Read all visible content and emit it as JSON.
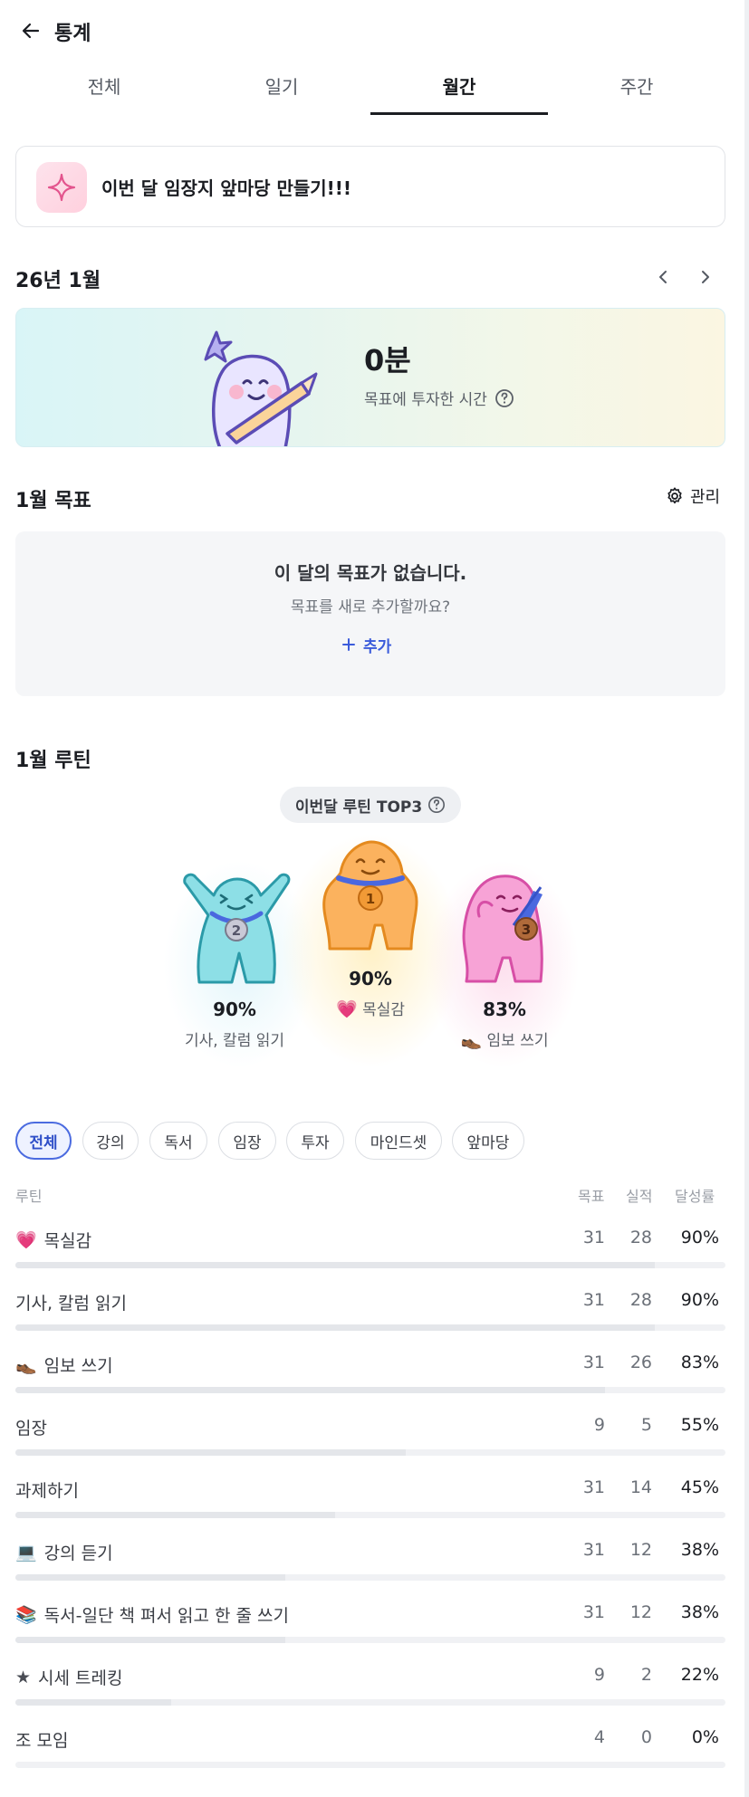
{
  "header": {
    "title": "통계"
  },
  "tabs": [
    {
      "label": "전체",
      "active": false
    },
    {
      "label": "일기",
      "active": false
    },
    {
      "label": "월간",
      "active": true
    },
    {
      "label": "주간",
      "active": false
    }
  ],
  "banner": {
    "text": "이번 달 임장지 앞마당 만들기!!!",
    "icon": "sparkle-icon"
  },
  "month": {
    "label": "26년 1월"
  },
  "hero": {
    "value": "0분",
    "label": "목표에 투자한 시간"
  },
  "goals": {
    "title": "1월 목표",
    "manage_label": "관리",
    "empty_title": "이 달의 목표가 없습니다.",
    "empty_sub": "목표를 새로 추가할까요?",
    "add_label": "추가"
  },
  "routines": {
    "title": "1월 루틴",
    "top3_label": "이번달 루틴 TOP3",
    "podium": [
      {
        "rank": 1,
        "percent": "90%",
        "name": "목실감",
        "emoji": "💗"
      },
      {
        "rank": 2,
        "percent": "90%",
        "name": "기사, 칼럼 읽기",
        "emoji": ""
      },
      {
        "rank": 3,
        "percent": "83%",
        "name": "임보 쓰기",
        "emoji": "👞"
      }
    ],
    "filters": [
      "전체",
      "강의",
      "독서",
      "임장",
      "투자",
      "마인드셋",
      "앞마당"
    ],
    "table_headers": {
      "routine": "루틴",
      "target": "목표",
      "actual": "실적",
      "rate": "달성률"
    },
    "rows": [
      {
        "emoji": "💗",
        "name": "목실감",
        "target": "31",
        "actual": "28",
        "rate": "90%",
        "progress": 0.9
      },
      {
        "emoji": "",
        "name": "기사, 칼럼 읽기",
        "target": "31",
        "actual": "28",
        "rate": "90%",
        "progress": 0.9
      },
      {
        "emoji": "👞",
        "name": "임보 쓰기",
        "target": "31",
        "actual": "26",
        "rate": "83%",
        "progress": 0.83
      },
      {
        "emoji": "",
        "name": "임장",
        "target": "9",
        "actual": "5",
        "rate": "55%",
        "progress": 0.55
      },
      {
        "emoji": "",
        "name": "과제하기",
        "target": "31",
        "actual": "14",
        "rate": "45%",
        "progress": 0.45
      },
      {
        "emoji": "💻",
        "name": "강의 듣기",
        "target": "31",
        "actual": "12",
        "rate": "38%",
        "progress": 0.38
      },
      {
        "emoji": "📚",
        "name": "독서-일단 책 펴서 읽고 한 줄 쓰기",
        "target": "31",
        "actual": "12",
        "rate": "38%",
        "progress": 0.38
      },
      {
        "emoji": "★",
        "name": "시세 트레킹",
        "target": "9",
        "actual": "2",
        "rate": "22%",
        "progress": 0.22
      },
      {
        "emoji": "",
        "name": "조 모임",
        "target": "4",
        "actual": "0",
        "rate": "0%",
        "progress": 0.0
      }
    ]
  },
  "colors": {
    "accent": "#3b5bdb",
    "chip_active": "#4b6be0",
    "rank1": "#f9a94b",
    "rank2": "#62cfd8",
    "rank3": "#f27cc0"
  }
}
